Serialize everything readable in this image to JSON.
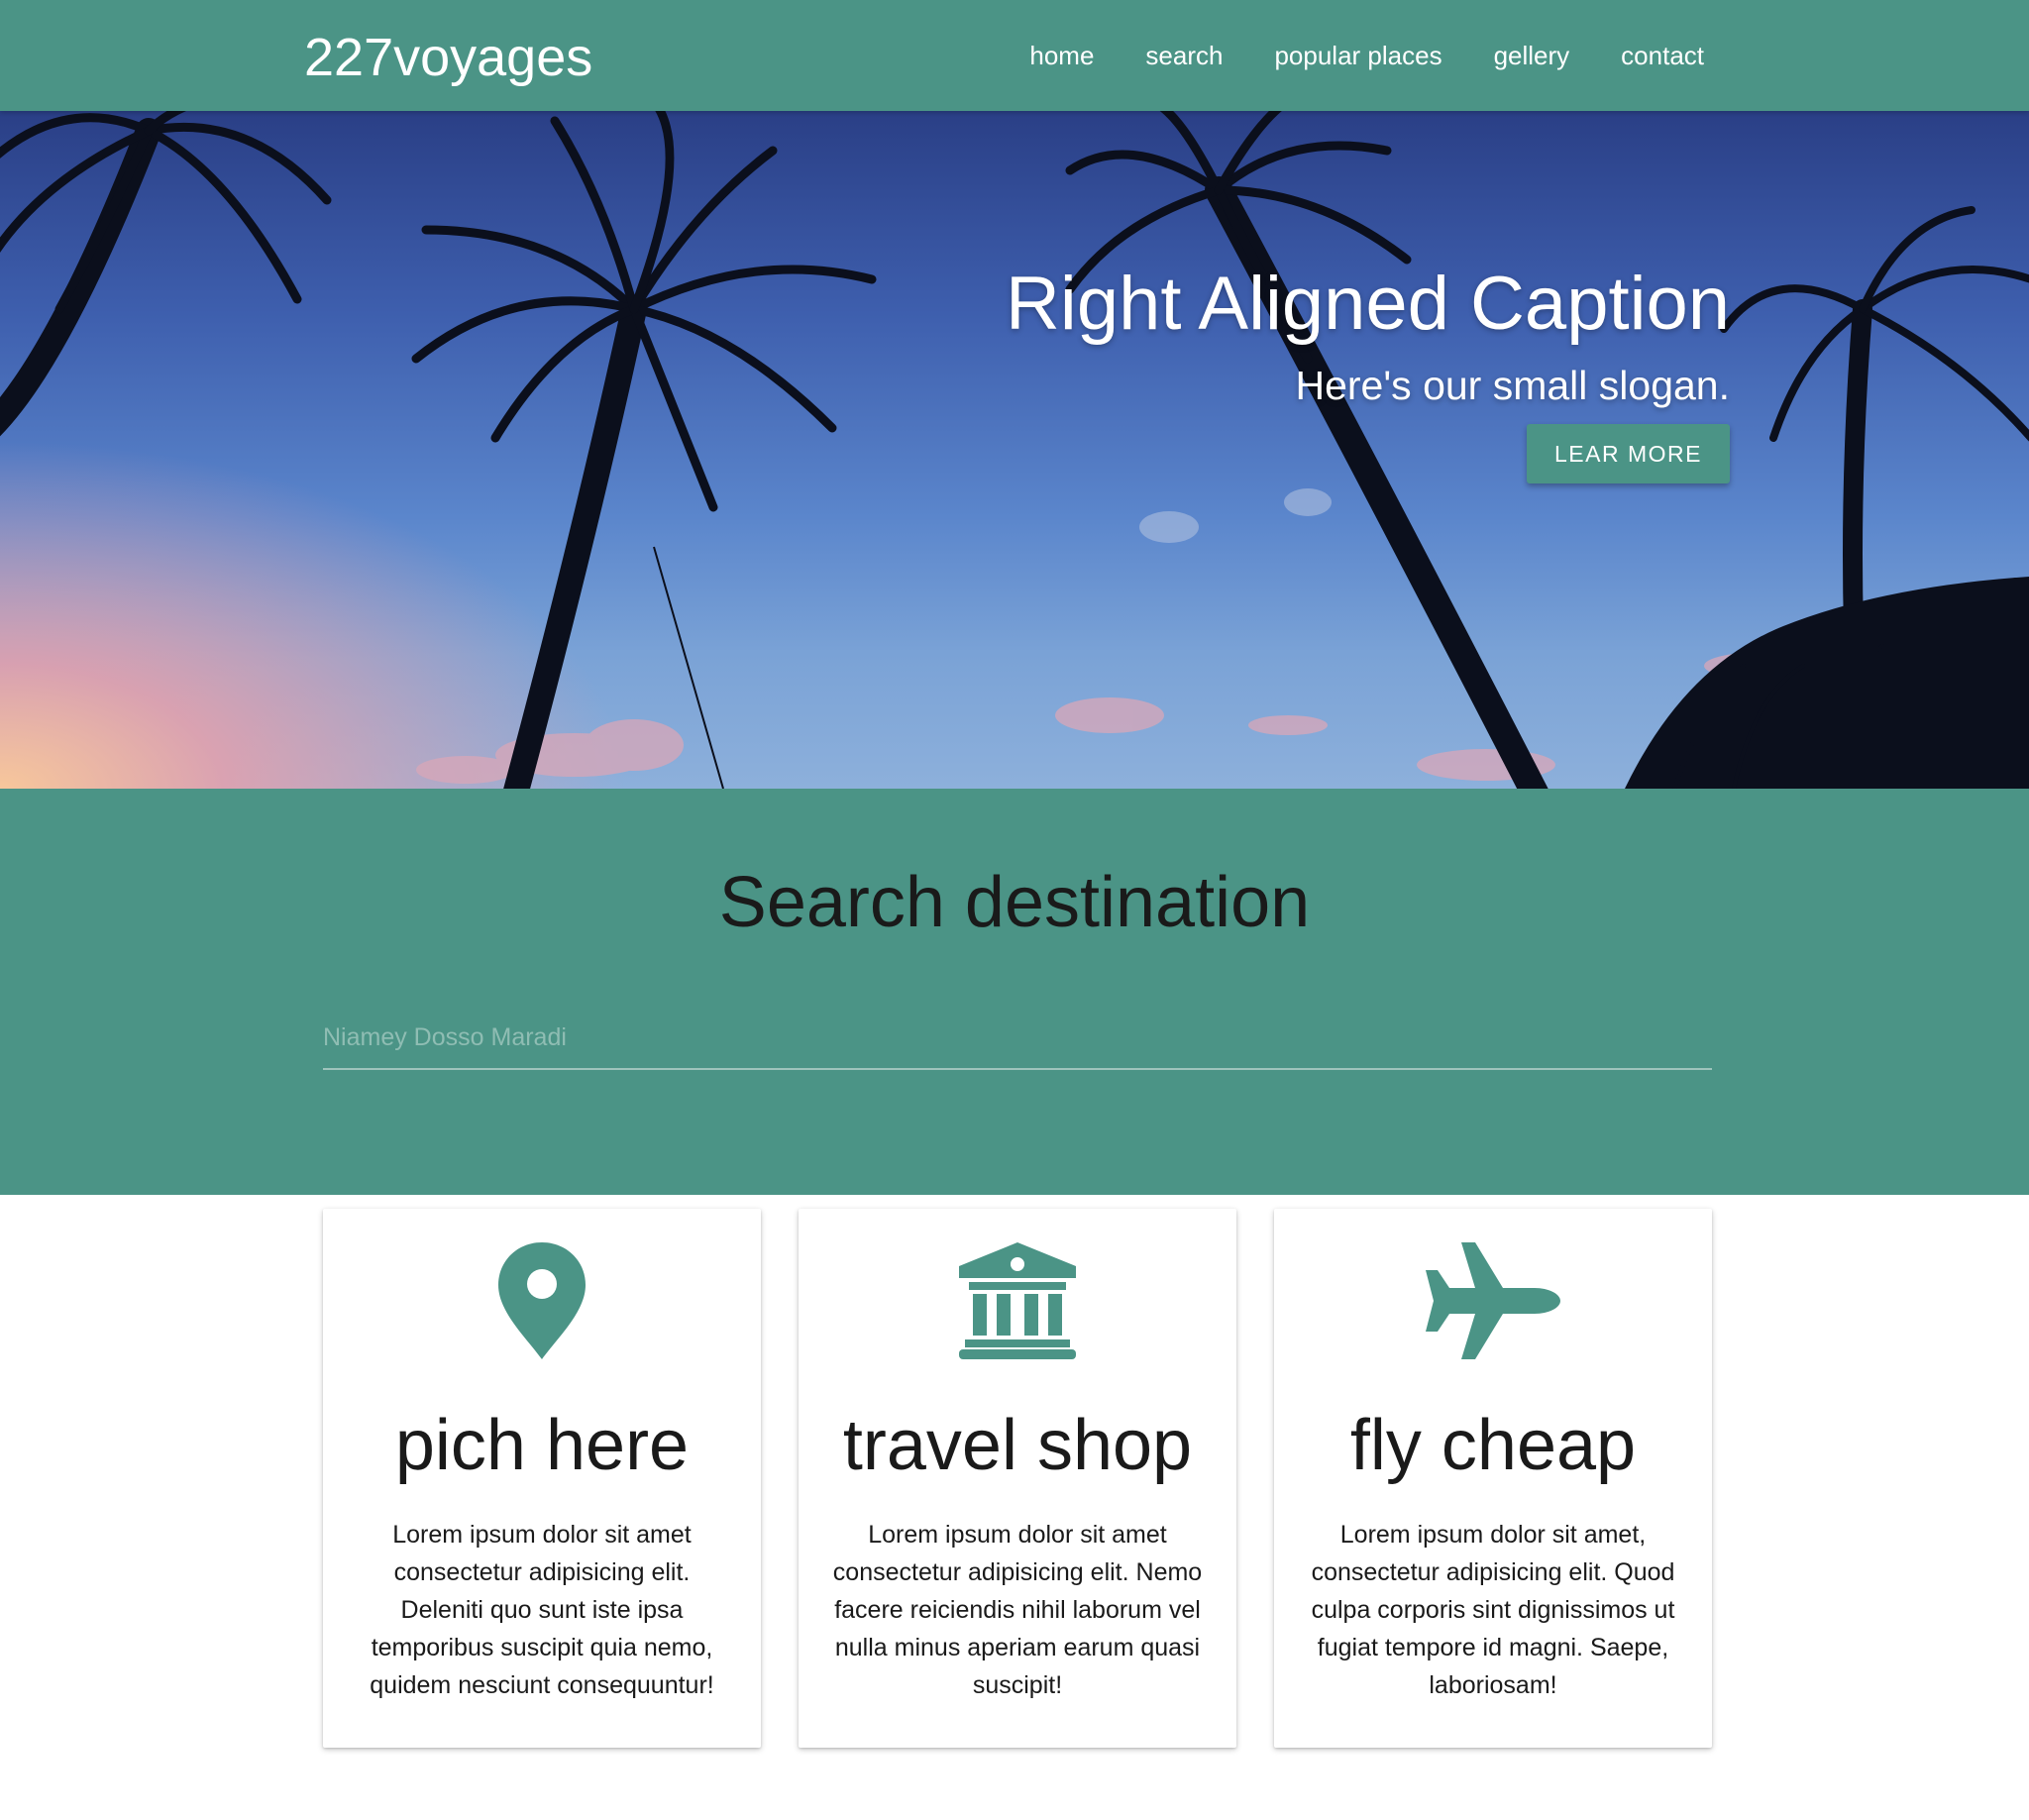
{
  "nav": {
    "brand": "227voyages",
    "links": [
      "home",
      "search",
      "popular places",
      "gellery",
      "contact"
    ]
  },
  "hero": {
    "title": "Right Aligned Caption",
    "slogan": "Here's our small slogan.",
    "button_label": "LEAR MORE"
  },
  "search": {
    "title": "Search destination",
    "placeholder": "Niamey Dosso Maradi"
  },
  "cards": [
    {
      "icon": "map-pin-icon",
      "title": "pich here",
      "text": "Lorem ipsum dolor sit amet consectetur adipisicing elit. Deleniti quo sunt iste ipsa temporibus suscipit quia nemo, quidem nesciunt consequuntur!"
    },
    {
      "icon": "bank-building-icon",
      "title": "travel shop",
      "text": "Lorem ipsum dolor sit amet consectetur adipisicing elit. Nemo facere reiciendis nihil laborum vel nulla minus aperiam earum quasi suscipit!"
    },
    {
      "icon": "airplane-icon",
      "title": "fly cheap",
      "text": "Lorem ipsum dolor sit amet, consectetur adipisicing elit. Quod culpa corporis sint dignissimos ut fugiat tempore id magni. Saepe, laboriosam!"
    }
  ],
  "colors": {
    "primary": "#4b9486",
    "text": "#1a1a1a"
  }
}
